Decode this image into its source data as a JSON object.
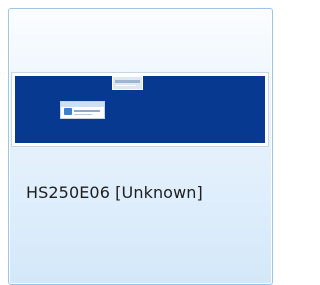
{
  "device": {
    "label": "HS250E06 [Unknown]"
  },
  "colors": {
    "thumbnail_background": "#06398f",
    "tile_border": "#9ec4e6",
    "tile_gradient_bottom": "#d4e8fa"
  }
}
